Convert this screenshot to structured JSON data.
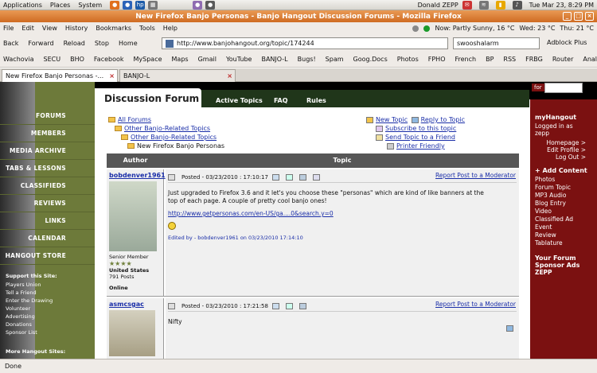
{
  "gnome_panel": {
    "menus": [
      "Applications",
      "Places",
      "System"
    ],
    "user": "Donald ZEPP",
    "clock": "Tue Mar 23,  8:29 PM"
  },
  "window": {
    "title": "New Firefox Banjo Personas - Banjo Hangout Discussion Forums - Mozilla Firefox"
  },
  "menubar": {
    "items": [
      "File",
      "Edit",
      "View",
      "History",
      "Bookmarks",
      "Tools",
      "Help"
    ],
    "weather_now": "Now: Partly Sunny, 16 °C",
    "weather_wed": "Wed: 23 °C",
    "weather_thu": "Thu: 21 °C"
  },
  "navbar": {
    "back": "Back",
    "forward": "Forward",
    "reload": "Reload",
    "stop": "Stop",
    "home": "Home",
    "url": "http://www.banjohangout.org/topic/174244",
    "search": "swooshalarm",
    "adblock": "Adblock Plus"
  },
  "bookmarks": [
    "Wachovia",
    "SECU",
    "BHO",
    "Facebook",
    "MySpace",
    "Maps",
    "Gmail",
    "YouTube",
    "BANJO-L",
    "Bugs!",
    "Spam",
    "Goog.Docs",
    "Photos",
    "FPHO",
    "French",
    "BP",
    "RSS",
    "FRBG",
    "Router",
    "Analytics"
  ],
  "tabs": [
    {
      "label": "New Firefox Banjo Personas -..."
    },
    {
      "label": "BANJO-L"
    }
  ],
  "site": {
    "left_nav": [
      "FORUMS",
      "MEMBERS",
      "MEDIA ARCHIVE",
      "TABS & LESSONS",
      "CLASSIFIEDS",
      "REVIEWS",
      "LINKS",
      "CALENDAR",
      "HANGOUT STORE"
    ],
    "support_heading": "Support this Site:",
    "support_links": [
      "Players Union",
      "Tell a Friend",
      "Enter the Drawing",
      "Volunteer",
      "Advertising",
      "Donations",
      "Sponsor List"
    ],
    "more_sites": "More Hangout Sites:",
    "forum_title": "Discussion Forum",
    "forum_tabs": [
      "Active Topics",
      "FAQ",
      "Rules"
    ],
    "for_label": "for",
    "crumbs": [
      "All Forums",
      "Other Banjo-Related Topics",
      "Other Banjo-Related Topics",
      "New Firefox Banjo Personas"
    ],
    "actions": [
      "New Topic",
      "Reply to Topic",
      "Subscribe to this topic",
      "Send Topic to a Friend",
      "Printer Friendly"
    ],
    "table_header": {
      "author": "Author",
      "topic": "Topic"
    },
    "posts": [
      {
        "author": "bobdenver1961",
        "posted": "Posted - 03/23/2010 :  17:10:17",
        "report": "Report Post to a Moderator",
        "text": "Just upgraded to Firefox 3.6 and it let's you choose these \"personas\" which are kind of like banners at the top of each page. A couple of pretty cool banjo ones!",
        "link": "http://www.getpersonas.com/en-US/ga....0&search.y=0",
        "edited": "Edited by - bobdenver1961 on 03/23/2010 17:14:10",
        "rank": "Senior Member",
        "country": "United States",
        "posts_count": "791 Posts",
        "online": "Online"
      },
      {
        "author": "asmcsgac",
        "posted": "Posted - 03/23/2010 :  17:21:58",
        "report": "Report Post to a Moderator",
        "text": "Nifty"
      }
    ],
    "right": {
      "heading": "myHangout",
      "logged": "Logged in as",
      "user": "zepp",
      "links": [
        "Homepage >",
        "Edit Profile >",
        "Log Out >"
      ],
      "add_heading": "+ Add Content",
      "add_links": [
        "Photos",
        "Forum Topic",
        "MP3 Audio",
        "Blog Entry",
        "Video",
        "Classified Ad",
        "Event",
        "Review",
        "Tablature"
      ],
      "sponsor_h1": "Your Forum",
      "sponsor_h2": "Sponsor Ads",
      "sponsor": "ZEPP"
    }
  },
  "statusbar": {
    "text": "Done"
  }
}
